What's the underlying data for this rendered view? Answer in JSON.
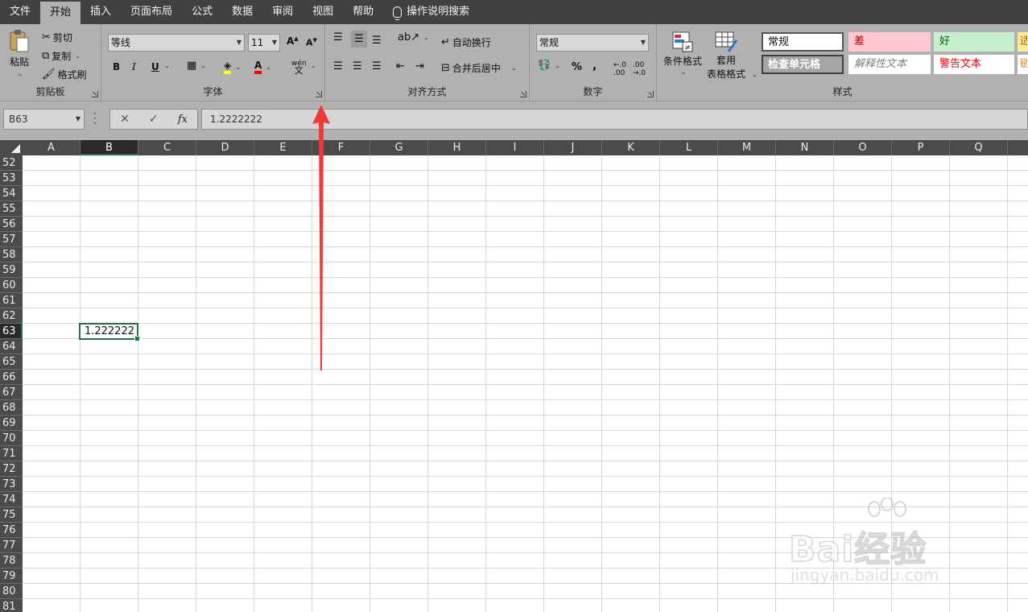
{
  "menu": {
    "tabs": [
      "文件",
      "开始",
      "插入",
      "页面布局",
      "公式",
      "数据",
      "审阅",
      "视图",
      "帮助"
    ],
    "active": "开始",
    "search_label": "操作说明搜索"
  },
  "ribbon": {
    "clipboard": {
      "label": "剪贴板",
      "paste": "粘贴",
      "cut": "剪切",
      "copy": "复制",
      "format_painter": "格式刷"
    },
    "font": {
      "label": "字体",
      "font_name": "等线",
      "font_size": "11",
      "bold": "B",
      "italic": "I",
      "underline": "U",
      "phonetic": "wén"
    },
    "alignment": {
      "label": "对齐方式",
      "wrap_text": "自动换行",
      "merge_center": "合并后居中"
    },
    "number": {
      "label": "数字",
      "format": "常规",
      "percent": "%",
      "comma": ","
    },
    "styles": {
      "label": "样式",
      "conditional_format": "条件格式",
      "table_format_line1": "套用",
      "table_format_line2": "表格格式",
      "cells": [
        {
          "text": "常规",
          "bg": "#ffffff",
          "color": "#111111"
        },
        {
          "text": "差",
          "bg": "#ffc7ce",
          "color": "#9c0006"
        },
        {
          "text": "好",
          "bg": "#c6efce",
          "color": "#006100"
        },
        {
          "text": "检查单元格",
          "bg": "#a5a5a5",
          "color": "#ffffff"
        },
        {
          "text": "解释性文本",
          "bg": "#ffffff",
          "color": "#7f7f7f"
        },
        {
          "text": "警告文本",
          "bg": "#ffffff",
          "color": "#ff0000"
        }
      ],
      "partial_1": "适",
      "partial_2": "链"
    }
  },
  "formula_bar": {
    "name_box": "B63",
    "cancel": "✕",
    "enter": "✓",
    "fx": "fx",
    "value": "1.2222222"
  },
  "grid": {
    "columns": [
      "A",
      "B",
      "C",
      "D",
      "E",
      "F",
      "G",
      "H",
      "I",
      "J",
      "K",
      "L",
      "M",
      "N",
      "O",
      "P",
      "Q"
    ],
    "selected_column": "B",
    "rows": [
      "52",
      "53",
      "54",
      "55",
      "56",
      "57",
      "58",
      "59",
      "60",
      "61",
      "62",
      "63",
      "64",
      "65",
      "66",
      "67",
      "68",
      "69",
      "70",
      "71",
      "72",
      "73",
      "74",
      "75",
      "76",
      "77",
      "78",
      "79",
      "80",
      "81"
    ],
    "selected_row": "63",
    "active_cell_display": "1.222222"
  },
  "watermark": {
    "logo": "Bai经验",
    "url": "jingyan.baidu.com"
  },
  "colors": {
    "accent": "#217346",
    "annotation": "#f03a3a"
  }
}
